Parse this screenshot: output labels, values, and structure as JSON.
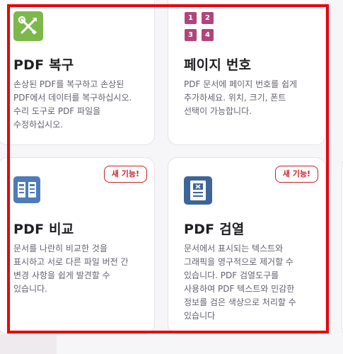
{
  "cards": [
    {
      "title": "PDF 복구",
      "description": "손상된 PDF를 복구하고 손상된 PDF에서 데이터를 복구하십시오. 수리 도구로 PDF 파일을 수정하십시오.",
      "icon": "repair-tools-icon",
      "icon_color": "#7cb84a"
    },
    {
      "title": "페이지 번호",
      "description": "PDF 문서에 페이지 번호를 쉽게 추가하세요. 위치, 크기, 폰트 선택이 가능합니다.",
      "icon": "page-number-grid-icon",
      "icon_color": "#b0457a",
      "grid": [
        "1",
        "2",
        "3",
        "4"
      ]
    },
    {
      "title": "PDF 비교",
      "description": "문서를 나란히 비교한 것을 표시하고 서로 다른 파일 버전 간 변경 사항을 쉽게 발견할 수 있습니다.",
      "icon": "compare-documents-icon",
      "icon_color": "#4f7bb8",
      "badge": "새 기능!"
    },
    {
      "title": "PDF 검열",
      "description": "문서에서 표시되는 텍스트와 그래픽을 영구적으로 제거할 수 있습니다. PDF 검열도구를 사용하여 PDF 텍스트와 민감한 정보를 검은 색상으로 처리할 수 있습니다",
      "icon": "redact-document-icon",
      "icon_color": "#3d6597",
      "badge": "새 기능!"
    }
  ],
  "colors": {
    "highlight_border": "#e8000b",
    "badge": "#c8202b",
    "title": "#1f1f24",
    "description": "#666070"
  }
}
